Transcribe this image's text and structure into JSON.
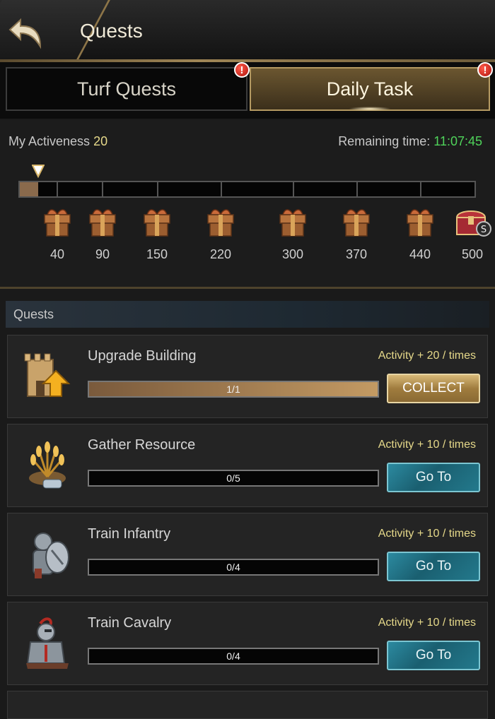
{
  "header": {
    "title": "Quests"
  },
  "tabs": [
    {
      "label": "Turf Quests",
      "selected": false,
      "alert": "!"
    },
    {
      "label": "Daily Task",
      "selected": true,
      "alert": "!"
    }
  ],
  "activeness": {
    "label": "My Activeness",
    "value": "20",
    "remaining_label": "Remaining time:",
    "remaining_value": "11:07:45",
    "progress_fraction": 0.04,
    "thresholds": [
      "40",
      "90",
      "150",
      "220",
      "300",
      "370",
      "440",
      "500"
    ]
  },
  "quests": {
    "header": "Quests",
    "items": [
      {
        "name": "Upgrade Building",
        "reward": "Activity + 20 / times",
        "progress": "1/1",
        "fraction": 1.0,
        "button": "COLLECT",
        "icon": "building-upgrade-icon"
      },
      {
        "name": "Gather Resource",
        "reward": "Activity + 10 / times",
        "progress": "0/5",
        "fraction": 0,
        "button": "Go To",
        "icon": "wheat-resource-icon"
      },
      {
        "name": "Train Infantry",
        "reward": "Activity + 10 / times",
        "progress": "0/4",
        "fraction": 0,
        "button": "Go To",
        "icon": "infantry-soldier-icon"
      },
      {
        "name": "Train Cavalry",
        "reward": "Activity + 10 / times",
        "progress": "0/4",
        "fraction": 0,
        "button": "Go To",
        "icon": "cavalry-knight-icon"
      }
    ]
  },
  "colors": {
    "gold_text": "#e6d98a",
    "green_time": "#4fd35a",
    "go_button": "#1a5f70",
    "collect_button": "#a07c3e"
  }
}
